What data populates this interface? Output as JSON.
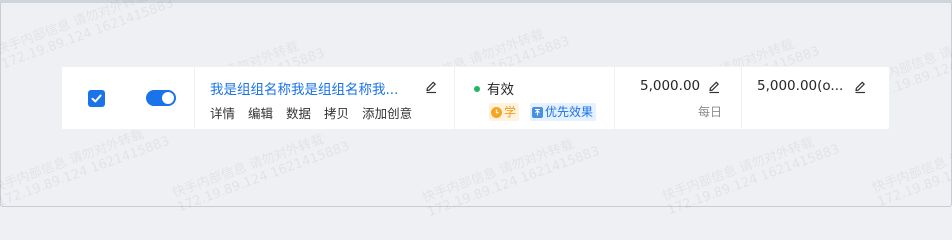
{
  "row": {
    "checked": true,
    "enabled": true,
    "name": "我是组组名称我是组组名称我...",
    "operations": [
      "详情",
      "编辑",
      "数据",
      "拷贝",
      "添加创意"
    ],
    "status": "有效",
    "status_color": "#1fb861",
    "tags": [
      {
        "label": "学",
        "icon": "clock-icon",
        "color": "#f39c12"
      },
      {
        "label": "优先效果",
        "icon": "priority-icon",
        "color": "#1a73e8"
      }
    ],
    "bid": "5,000.00",
    "bid_period": "每日",
    "budget": "5,000.00(o..."
  },
  "watermark": {
    "line1": "快手内部信息 请勿对外转载",
    "line2": "172.19.89.124 1621415883"
  },
  "colors": {
    "accent": "#1a73e8",
    "background": "#eef0f4"
  }
}
